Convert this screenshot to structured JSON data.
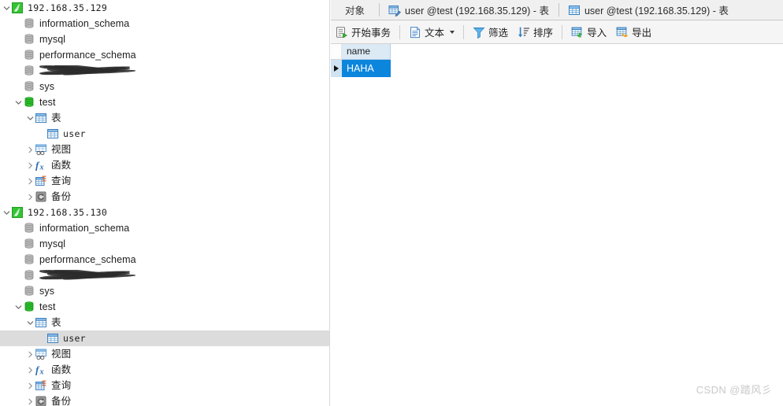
{
  "app": {
    "watermark": "CSDN @踏风彡",
    "accent_blue": "#0c85dd",
    "header_blue": "#dbeaf5",
    "selection_gray": "#dcdcdc",
    "conn_green": "#2ebd2e"
  },
  "sidebar": {
    "nodes": [
      {
        "label": "192.168.35.129",
        "icon": "connection-icon",
        "indent": 0,
        "twisty": "expanded",
        "selected": false,
        "mono": true
      },
      {
        "label": "information_schema",
        "icon": "database-gray-icon",
        "indent": 1,
        "twisty": "none",
        "selected": false,
        "mono": false
      },
      {
        "label": "mysql",
        "icon": "database-gray-icon",
        "indent": 1,
        "twisty": "none",
        "selected": false,
        "mono": false
      },
      {
        "label": "performance_schema",
        "icon": "database-gray-icon",
        "indent": 1,
        "twisty": "none",
        "selected": false,
        "mono": false
      },
      {
        "label": "",
        "icon": "database-gray-icon",
        "indent": 1,
        "twisty": "none",
        "selected": false,
        "mono": false,
        "redacted": true
      },
      {
        "label": "sys",
        "icon": "database-gray-icon",
        "indent": 1,
        "twisty": "none",
        "selected": false,
        "mono": false
      },
      {
        "label": "test",
        "icon": "database-green-icon",
        "indent": 1,
        "twisty": "expanded",
        "selected": false,
        "mono": false
      },
      {
        "label": "表",
        "icon": "table-icon",
        "indent": 2,
        "twisty": "expanded",
        "selected": false,
        "mono": false
      },
      {
        "label": "user",
        "icon": "table-icon",
        "indent": 3,
        "twisty": "none",
        "selected": false,
        "mono": true
      },
      {
        "label": "视图",
        "icon": "view-icon",
        "indent": 2,
        "twisty": "collapsed",
        "selected": false,
        "mono": false
      },
      {
        "label": "函数",
        "icon": "function-icon",
        "indent": 2,
        "twisty": "collapsed",
        "selected": false,
        "mono": false
      },
      {
        "label": "查询",
        "icon": "query-icon",
        "indent": 2,
        "twisty": "collapsed",
        "selected": false,
        "mono": false
      },
      {
        "label": "备份",
        "icon": "backup-icon",
        "indent": 2,
        "twisty": "collapsed",
        "selected": false,
        "mono": false
      },
      {
        "label": "192.168.35.130",
        "icon": "connection-icon",
        "indent": 0,
        "twisty": "expanded",
        "selected": false,
        "mono": true
      },
      {
        "label": "information_schema",
        "icon": "database-gray-icon",
        "indent": 1,
        "twisty": "none",
        "selected": false,
        "mono": false
      },
      {
        "label": "mysql",
        "icon": "database-gray-icon",
        "indent": 1,
        "twisty": "none",
        "selected": false,
        "mono": false
      },
      {
        "label": "performance_schema",
        "icon": "database-gray-icon",
        "indent": 1,
        "twisty": "none",
        "selected": false,
        "mono": false
      },
      {
        "label": "",
        "icon": "database-gray-icon",
        "indent": 1,
        "twisty": "none",
        "selected": false,
        "mono": false,
        "redacted": true
      },
      {
        "label": "sys",
        "icon": "database-gray-icon",
        "indent": 1,
        "twisty": "none",
        "selected": false,
        "mono": false
      },
      {
        "label": "test",
        "icon": "database-green-icon",
        "indent": 1,
        "twisty": "expanded",
        "selected": false,
        "mono": false
      },
      {
        "label": "表",
        "icon": "table-icon",
        "indent": 2,
        "twisty": "expanded",
        "selected": false,
        "mono": false
      },
      {
        "label": "user",
        "icon": "table-icon",
        "indent": 3,
        "twisty": "none",
        "selected": true,
        "mono": true
      },
      {
        "label": "视图",
        "icon": "view-icon",
        "indent": 2,
        "twisty": "collapsed",
        "selected": false,
        "mono": false
      },
      {
        "label": "函数",
        "icon": "function-icon",
        "indent": 2,
        "twisty": "collapsed",
        "selected": false,
        "mono": false
      },
      {
        "label": "查询",
        "icon": "query-icon",
        "indent": 2,
        "twisty": "collapsed",
        "selected": false,
        "mono": false
      },
      {
        "label": "备份",
        "icon": "backup-icon",
        "indent": 2,
        "twisty": "collapsed",
        "selected": false,
        "mono": false
      }
    ]
  },
  "tabs": [
    {
      "label": "对象",
      "icon": "none",
      "active": false
    },
    {
      "label": "user @test (192.168.35.129) - 表",
      "icon": "table-design-icon",
      "active": false
    },
    {
      "label": "user @test (192.168.35.129) - 表",
      "icon": "table-data-icon",
      "active": false
    }
  ],
  "toolbar": {
    "buttons": [
      {
        "label": "开始事务",
        "icon": "begin-transaction-icon",
        "dropdown": false
      },
      {
        "label": "文本",
        "icon": "text-icon",
        "dropdown": true
      },
      {
        "label": "筛选",
        "icon": "filter-icon",
        "dropdown": false
      },
      {
        "label": "排序",
        "icon": "sort-icon",
        "dropdown": false
      },
      {
        "label": "导入",
        "icon": "import-icon",
        "dropdown": false
      },
      {
        "label": "导出",
        "icon": "export-icon",
        "dropdown": false
      }
    ]
  },
  "grid": {
    "columns": [
      "name"
    ],
    "rows": [
      {
        "cells": [
          "HAHA"
        ],
        "selected": true
      }
    ]
  }
}
